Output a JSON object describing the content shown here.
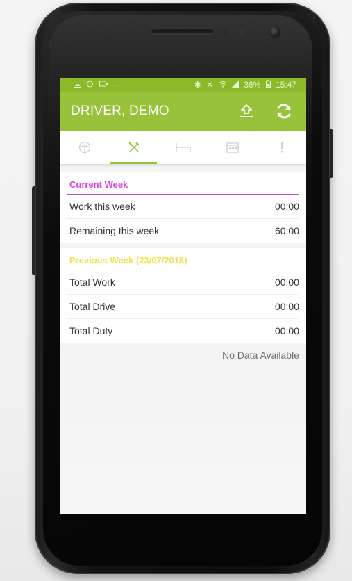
{
  "status_bar": {
    "left_icons": [
      "image-icon",
      "power-icon",
      "message-icon",
      "more-icon"
    ],
    "right_text": "36%",
    "time": "15:47"
  },
  "app_bar": {
    "title": "DRIVER, DEMO",
    "upload_icon": "upload-icon",
    "refresh_icon": "refresh-icon"
  },
  "tabs": [
    {
      "icon": "steering-wheel-icon",
      "active": false
    },
    {
      "icon": "tools-icon",
      "active": true
    },
    {
      "icon": "bed-icon",
      "active": false
    },
    {
      "icon": "calendar-icon",
      "active": false
    },
    {
      "icon": "alert-icon",
      "active": false
    }
  ],
  "current_week": {
    "title": "Current Week",
    "rows": [
      {
        "label": "Work this week",
        "value": "00:00"
      },
      {
        "label": "Remaining this week",
        "value": "60:00"
      }
    ]
  },
  "previous_week": {
    "title": "Previous Week (23/07/2018)",
    "rows": [
      {
        "label": "Total Work",
        "value": "00:00"
      },
      {
        "label": "Total Drive",
        "value": "00:00"
      },
      {
        "label": "Total Duty",
        "value": "00:00"
      }
    ]
  },
  "no_data": "No Data Available",
  "colors": {
    "status_bar": "#8bb92a",
    "app_bar": "#97c23a",
    "current_week": "#d93ee0",
    "previous_week": "#f2e24a"
  }
}
